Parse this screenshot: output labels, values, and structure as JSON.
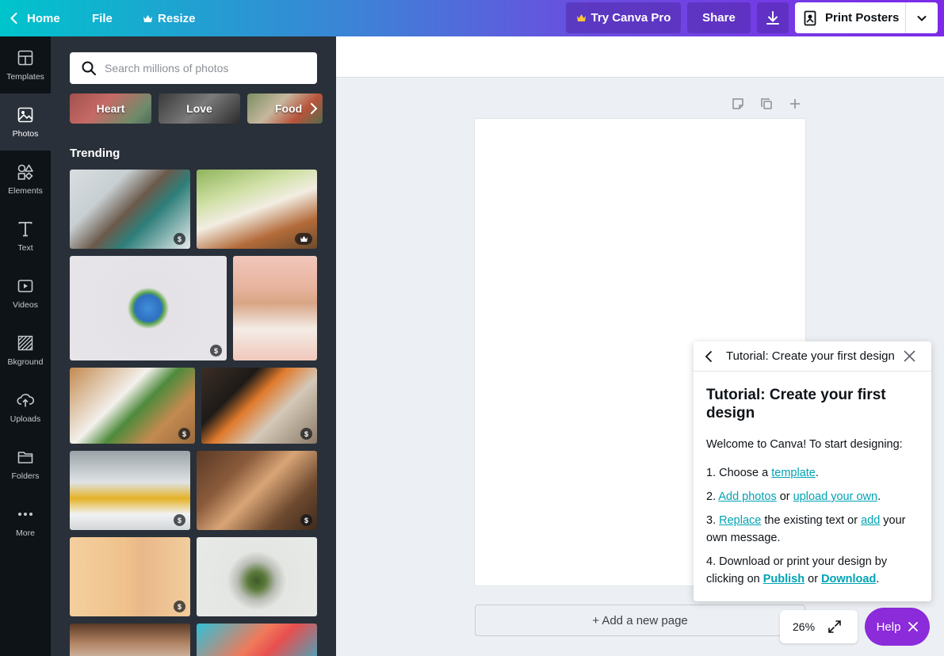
{
  "topbar": {
    "home_label": "Home",
    "file_label": "File",
    "resize_label": "Resize",
    "try_pro_label": "Try Canva Pro",
    "share_label": "Share",
    "print_label": "Print Posters"
  },
  "rail": {
    "items": [
      {
        "label": "Templates",
        "icon": "templates-icon"
      },
      {
        "label": "Photos",
        "icon": "photos-icon",
        "active": true
      },
      {
        "label": "Elements",
        "icon": "elements-icon"
      },
      {
        "label": "Text",
        "icon": "text-icon"
      },
      {
        "label": "Videos",
        "icon": "videos-icon"
      },
      {
        "label": "Bkground",
        "icon": "background-icon"
      },
      {
        "label": "Uploads",
        "icon": "uploads-icon"
      },
      {
        "label": "Folders",
        "icon": "folders-icon"
      },
      {
        "label": "More",
        "icon": "more-icon"
      }
    ]
  },
  "panel": {
    "search_placeholder": "Search millions of photos",
    "chips": [
      "Heart",
      "Love",
      "Food"
    ],
    "trending_label": "Trending",
    "price_badge": "$"
  },
  "workspace": {
    "add_page_label": "+ Add a new page",
    "zoom_level": "26%",
    "help_label": "Help"
  },
  "tutorial": {
    "header_title": "Tutorial: Create your first design",
    "title": "Tutorial: Create your first design",
    "intro": "Welcome to Canva! To start designing:",
    "step1_prefix": "1. Choose a ",
    "step1_link": "template",
    "step1_suffix": ".",
    "step2_prefix": "2. ",
    "step2_link1": "Add photos",
    "step2_mid": " or ",
    "step2_link2": "upload your own",
    "step2_suffix": ".",
    "step3_prefix": "3. ",
    "step3_link1": "Replace",
    "step3_mid": " the existing text or ",
    "step3_link2": "add",
    "step3_suffix": " your own message.",
    "step4_prefix": "4. Download or print your design by clicking on ",
    "step4_link1": "Publish",
    "step4_mid": " or ",
    "step4_link2": "Download",
    "step4_suffix": "."
  },
  "colors": {
    "brand_teal": "#00c4cc",
    "brand_purple": "#7d2ae8",
    "help_purple": "#8b2bd9",
    "link_teal": "#00a3b4"
  }
}
